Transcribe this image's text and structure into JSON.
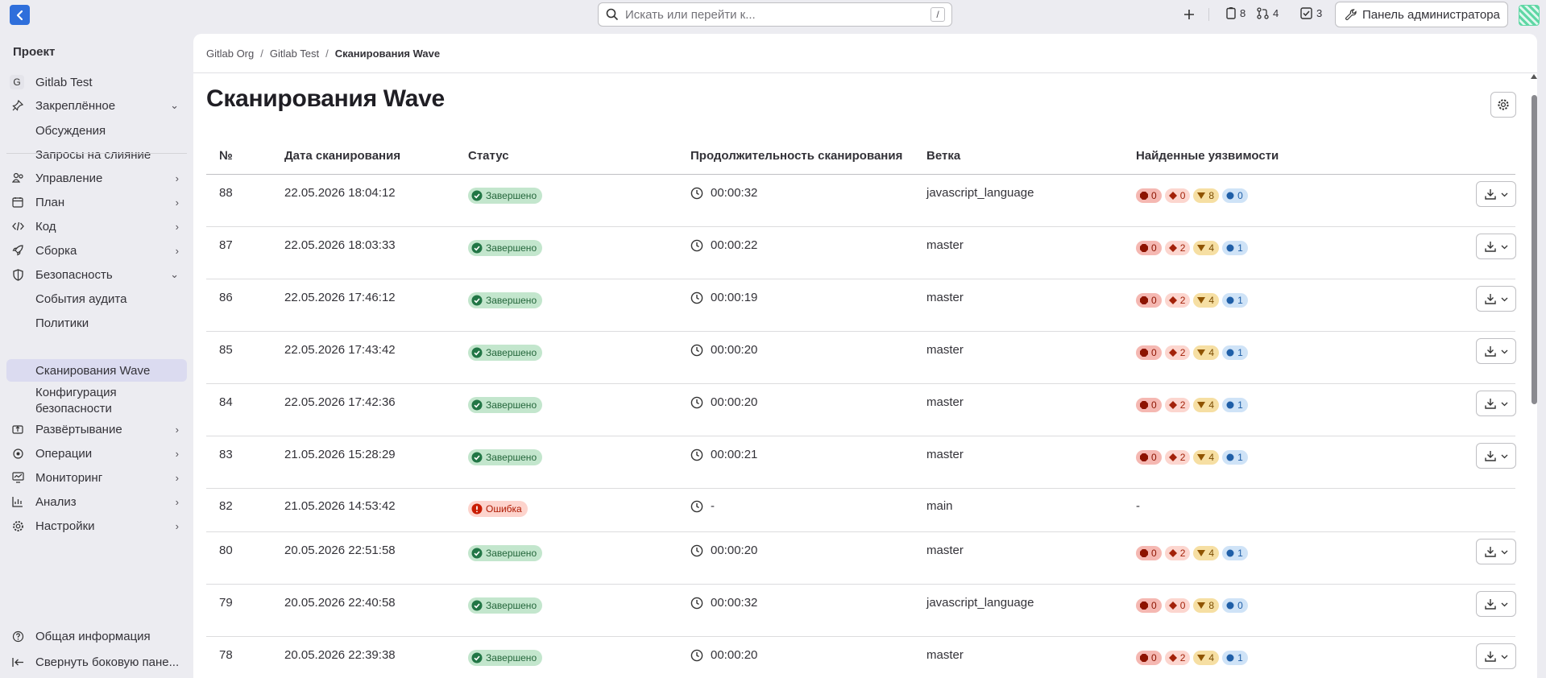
{
  "search": {
    "placeholder": "Искать или перейти к...",
    "shortcut": "/"
  },
  "topbar": {
    "issues_count": "8",
    "mr_count": "4",
    "todo_count": "3",
    "admin_label": "Панель администратора"
  },
  "sidebar": {
    "section_title": "Проект",
    "project_badge": "G",
    "project_name": "Gitlab Test",
    "pinned": "Закреплённое",
    "pinned_items": [
      "Обсуждения",
      "Запросы на слияние"
    ],
    "groups": [
      "Управление",
      "План",
      "Код",
      "Сборка",
      "Безопасность"
    ],
    "security_items": [
      "События аудита",
      "Политики",
      "Сканирования Wave",
      "Конфигурация",
      "безопасности"
    ],
    "groups2": [
      "Развёртывание",
      "Операции",
      "Мониторинг",
      "Анализ",
      "Настройки"
    ],
    "help": "Общая информация",
    "collapse": "Свернуть боковую пане..."
  },
  "breadcrumb": {
    "org": "Gitlab Org",
    "project": "Gitlab Test",
    "current": "Сканирования Wave"
  },
  "page": {
    "title": "Сканирования Wave"
  },
  "table": {
    "headers": [
      "№",
      "Дата сканирования",
      "Статус",
      "Продолжительность сканирования",
      "Ветка",
      "Найденные уязвимости"
    ],
    "rows": [
      {
        "id": "88",
        "date": "22.05.2026 18:04:12",
        "status": "Завершено",
        "ok": true,
        "duration": "00:00:32",
        "branch": "javascript_language",
        "v": [
          "0",
          "0",
          "8",
          "0"
        ]
      },
      {
        "id": "87",
        "date": "22.05.2026 18:03:33",
        "status": "Завершено",
        "ok": true,
        "duration": "00:00:22",
        "branch": "master",
        "v": [
          "0",
          "2",
          "4",
          "1"
        ]
      },
      {
        "id": "86",
        "date": "22.05.2026 17:46:12",
        "status": "Завершено",
        "ok": true,
        "duration": "00:00:19",
        "branch": "master",
        "v": [
          "0",
          "2",
          "4",
          "1"
        ]
      },
      {
        "id": "85",
        "date": "22.05.2026 17:43:42",
        "status": "Завершено",
        "ok": true,
        "duration": "00:00:20",
        "branch": "master",
        "v": [
          "0",
          "2",
          "4",
          "1"
        ]
      },
      {
        "id": "84",
        "date": "22.05.2026 17:42:36",
        "status": "Завершено",
        "ok": true,
        "duration": "00:00:20",
        "branch": "master",
        "v": [
          "0",
          "2",
          "4",
          "1"
        ]
      },
      {
        "id": "83",
        "date": "21.05.2026 15:28:29",
        "status": "Завершено",
        "ok": true,
        "duration": "00:00:21",
        "branch": "master",
        "v": [
          "0",
          "2",
          "4",
          "1"
        ]
      },
      {
        "id": "82",
        "date": "21.05.2026 14:53:42",
        "status": "Ошибка",
        "ok": false,
        "duration": "-",
        "branch": "main",
        "none": "-"
      },
      {
        "id": "80",
        "date": "20.05.2026 22:51:58",
        "status": "Завершено",
        "ok": true,
        "duration": "00:00:20",
        "branch": "master",
        "v": [
          "0",
          "2",
          "4",
          "1"
        ]
      },
      {
        "id": "79",
        "date": "20.05.2026 22:40:58",
        "status": "Завершено",
        "ok": true,
        "duration": "00:00:32",
        "branch": "javascript_language",
        "v": [
          "0",
          "0",
          "8",
          "0"
        ]
      },
      {
        "id": "78",
        "date": "20.05.2026 22:39:38",
        "status": "Завершено",
        "ok": true,
        "duration": "00:00:20",
        "branch": "master",
        "v": [
          "0",
          "2",
          "4",
          "1"
        ]
      }
    ]
  }
}
